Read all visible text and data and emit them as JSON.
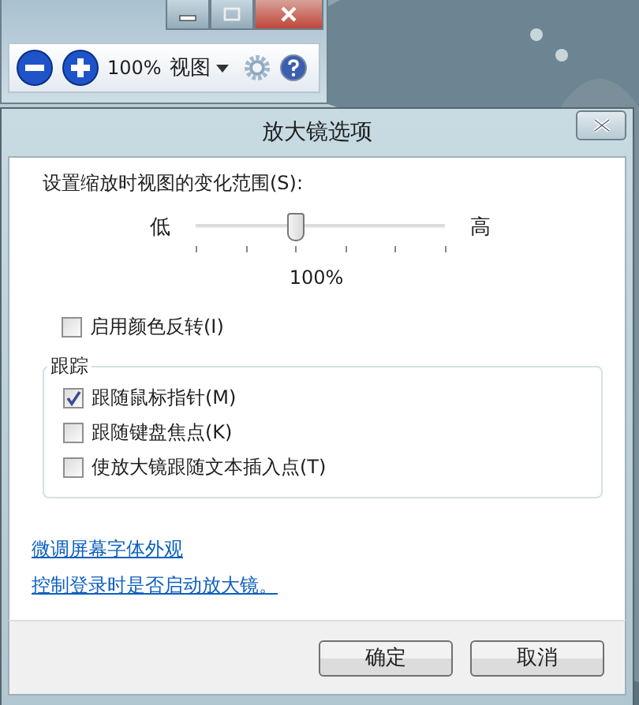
{
  "magnifier_toolbar": {
    "zoom": "100%",
    "view_menu": "视图"
  },
  "dialog": {
    "title": "放大镜选项",
    "zoom_range": {
      "label": "设置缩放时视图的变化范围(S):",
      "low": "低",
      "high": "高",
      "level": 0.4,
      "reading": "100%"
    },
    "invert_colors": {
      "label": "启用颜色反转(I)",
      "checked": false
    },
    "tracking": {
      "title": "跟踪",
      "options": [
        {
          "label": "跟随鼠标指针(M)",
          "checked": true
        },
        {
          "label": "跟随键盘焦点(K)",
          "checked": false
        },
        {
          "label": "使放大镜跟随文本插入点(T)",
          "checked": false
        }
      ]
    },
    "links": [
      "微调屏幕字体外观",
      "控制登录时是否启动放大镜。"
    ],
    "buttons": [
      "确定",
      "取消"
    ]
  }
}
